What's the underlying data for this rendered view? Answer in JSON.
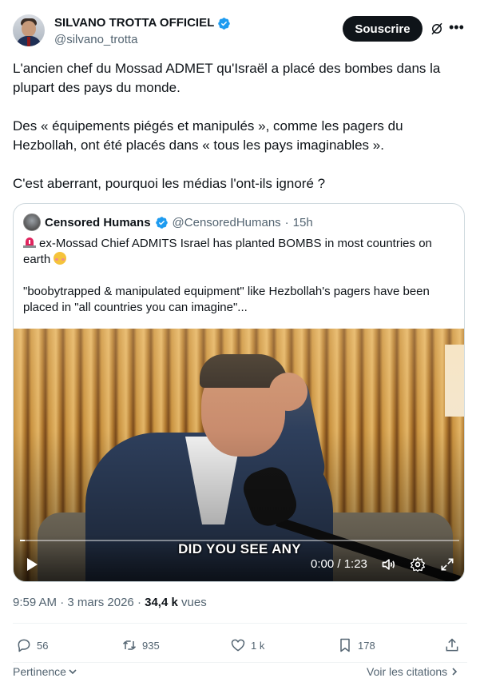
{
  "author": {
    "display_name": "SILVANO TROTTA OFFICIEL",
    "handle": "@silvano_trotta",
    "follow_label": "Souscrire"
  },
  "tweet": {
    "paragraphs": [
      "L'ancien chef du Mossad ADMET qu'Israël a placé des bombes dans la plupart des pays du monde.",
      "Des « équipements piégés et manipulés », comme les pagers du Hezbollah, ont été placés dans « tous les pays imaginables ».",
      "C'est aberrant, pourquoi les médias l'ont-ils ignoré ?"
    ]
  },
  "quote": {
    "display_name": "Censored Humans",
    "handle": "@CensoredHumans",
    "separator": "·",
    "time_ago": "15h",
    "line1": "ex-Mossad Chief ADMITS Israel has planted BOMBS in most countries on earth",
    "line2": "\"boobytrapped & manipulated equipment\" like Hezbollah's pagers have been placed in \"all countries you can imagine\"..."
  },
  "video": {
    "caption": "DID YOU SEE ANY",
    "time": "0:00 / 1:23",
    "progress": 0.01
  },
  "meta": {
    "time": "9:59 AM",
    "sep1": "·",
    "date": "3 mars 2026",
    "sep2": "·",
    "views_count": "34,4 k",
    "views_label": "vues"
  },
  "actions": {
    "replies": "56",
    "reposts": "935",
    "likes": "1 k",
    "bookmarks": "178"
  },
  "footer": {
    "sort_label": "Pertinence",
    "quotes_label": "Voir les citations"
  },
  "colors": {
    "text": "#0f1419",
    "secondary": "#536471",
    "verified": "#1d9bf0",
    "border": "#cfd9de"
  }
}
